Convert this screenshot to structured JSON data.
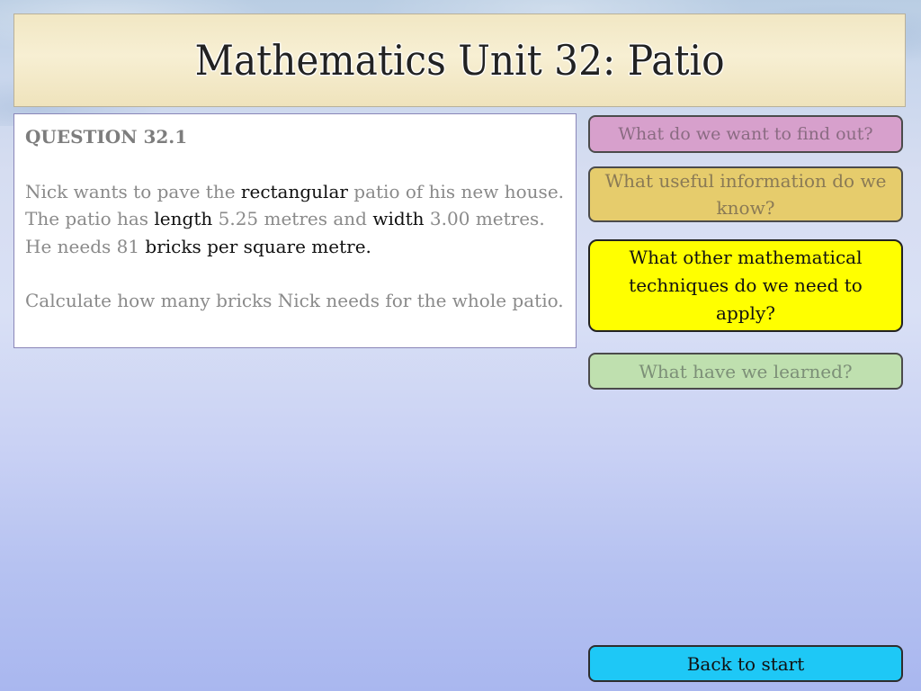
{
  "title": "Mathematics Unit 32: Patio",
  "question": {
    "heading": "QUESTION 32.1",
    "paragraph1": {
      "seg1": "Nick wants to pave the ",
      "seg2": "rectangular",
      "seg3": " patio of his new house.  The patio has ",
      "seg4": "length",
      "seg5": " 5.25 metres and ",
      "seg6": "width",
      "seg7": " 3.00 metres.  He needs 81 ",
      "seg8": "bricks per square metre."
    },
    "paragraph2": "Calculate how many bricks Nick needs for the whole patio."
  },
  "buttons": {
    "find_out": "What do we want to find out?",
    "useful_info": "What useful information do we know?",
    "techniques": "What other mathematical techniques do we need to apply?",
    "learned": "What have we learned?",
    "back": "Back to start"
  },
  "colors": {
    "find_out_bg": "#d7a0cc",
    "useful_info_bg": "#e6cc6c",
    "techniques_bg": "#ffff00",
    "learned_bg": "#bfe0af",
    "back_bg": "#1ec8f6"
  }
}
